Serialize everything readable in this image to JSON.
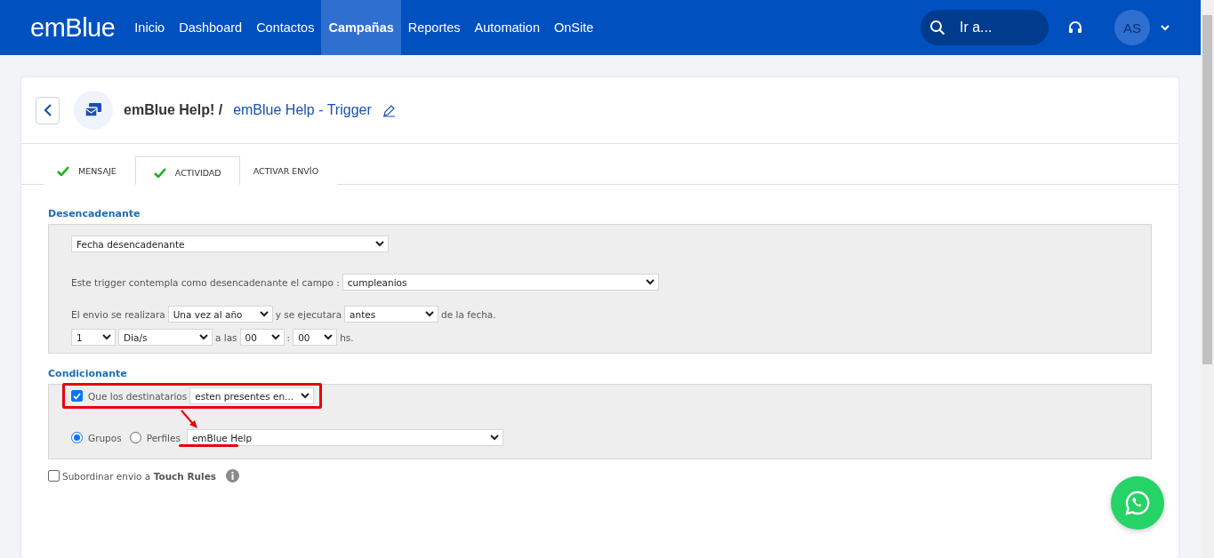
{
  "nav": {
    "logo": "emBlue",
    "items": [
      {
        "label": "Inicio",
        "selected": false
      },
      {
        "label": "Dashboard",
        "selected": false
      },
      {
        "label": "Contactos",
        "selected": false
      },
      {
        "label": "Campañas",
        "selected": true
      },
      {
        "label": "Reportes",
        "selected": false
      },
      {
        "label": "Automation",
        "selected": false
      },
      {
        "label": "OnSite",
        "selected": false
      }
    ],
    "search": {
      "placeholder": "Ir a..."
    },
    "avatar": "AS"
  },
  "header": {
    "parent": "emBlue Help! /",
    "title": "emBlue Help - Trigger"
  },
  "tabs": [
    {
      "label": "MENSAJE",
      "completed": true,
      "selected": false
    },
    {
      "label": "ACTIVIDAD",
      "completed": true,
      "selected": true
    },
    {
      "label": "ACTIVAR ENVÍO",
      "completed": false,
      "selected": false
    }
  ],
  "trigger": {
    "heading": "Desencadenante",
    "lines": [
      {
        "parts": [
          {
            "kind": "select",
            "value": "Fecha desencadenante"
          }
        ]
      },
      {
        "parts": [
          {
            "kind": "text",
            "value": "Este trigger contempla como desencadenante el campo :"
          },
          {
            "kind": "select",
            "value": "cumpleanios"
          }
        ]
      },
      {
        "parts": [
          {
            "kind": "text",
            "value": "El envio se realizara"
          },
          {
            "kind": "select",
            "value": "Una vez al año"
          },
          {
            "kind": "text",
            "value": "y se ejecutara"
          },
          {
            "kind": "select",
            "value": "antes"
          },
          {
            "kind": "text",
            "value": "de la fecha."
          }
        ]
      },
      {
        "parts": [
          {
            "kind": "select",
            "value": "1"
          },
          {
            "kind": "select",
            "value": "Dia/s"
          },
          {
            "kind": "text",
            "value": "a las"
          },
          {
            "kind": "select",
            "value": "00"
          },
          {
            "kind": "text",
            "value": ":"
          },
          {
            "kind": "select",
            "value": "00"
          },
          {
            "kind": "text",
            "value": "hs."
          }
        ]
      }
    ]
  },
  "condition": {
    "heading": "Condicionante",
    "checkbox": {
      "label": "Que los destinatarios",
      "checked": true
    },
    "mode": "esten presentes en...",
    "radios": [
      {
        "label": "Grupos",
        "selected": true
      },
      {
        "label": "Perfiles",
        "selected": false
      }
    ],
    "group": "emBlue Help"
  },
  "touch_rules": {
    "label": "Subordinar envio a **Touch Rules**",
    "checked": false
  }
}
